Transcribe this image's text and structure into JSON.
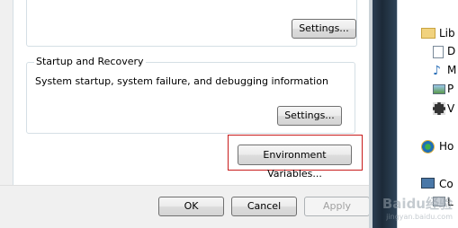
{
  "dialog": {
    "performance_group": {
      "settings_label": "Settings..."
    },
    "startup_group": {
      "title": "Startup and Recovery",
      "description": "System startup, system failure, and debugging information",
      "settings_label": "Settings..."
    },
    "env_vars_label": "Environment Variables...",
    "ok_label": "OK",
    "cancel_label": "Cancel",
    "apply_label": "Apply"
  },
  "explorer_nav": [
    {
      "label": "Lib",
      "icon": "libraries-icon"
    },
    {
      "label": "D",
      "icon": "documents-icon"
    },
    {
      "label": "M",
      "icon": "music-icon"
    },
    {
      "label": "P",
      "icon": "pictures-icon"
    },
    {
      "label": "V",
      "icon": "videos-icon"
    },
    {
      "label": "Ho",
      "icon": "homegroup-icon"
    },
    {
      "label": "Co",
      "icon": "computer-icon"
    },
    {
      "label": "L",
      "icon": "local-disk-icon"
    }
  ],
  "watermark": {
    "text": "Baidu经验",
    "sub": "jingyan.baidu.com"
  },
  "colors": {
    "highlight": "#c81c1c",
    "dialog_bg": "#f0f0f0",
    "taskbar": "#1c2a38"
  }
}
